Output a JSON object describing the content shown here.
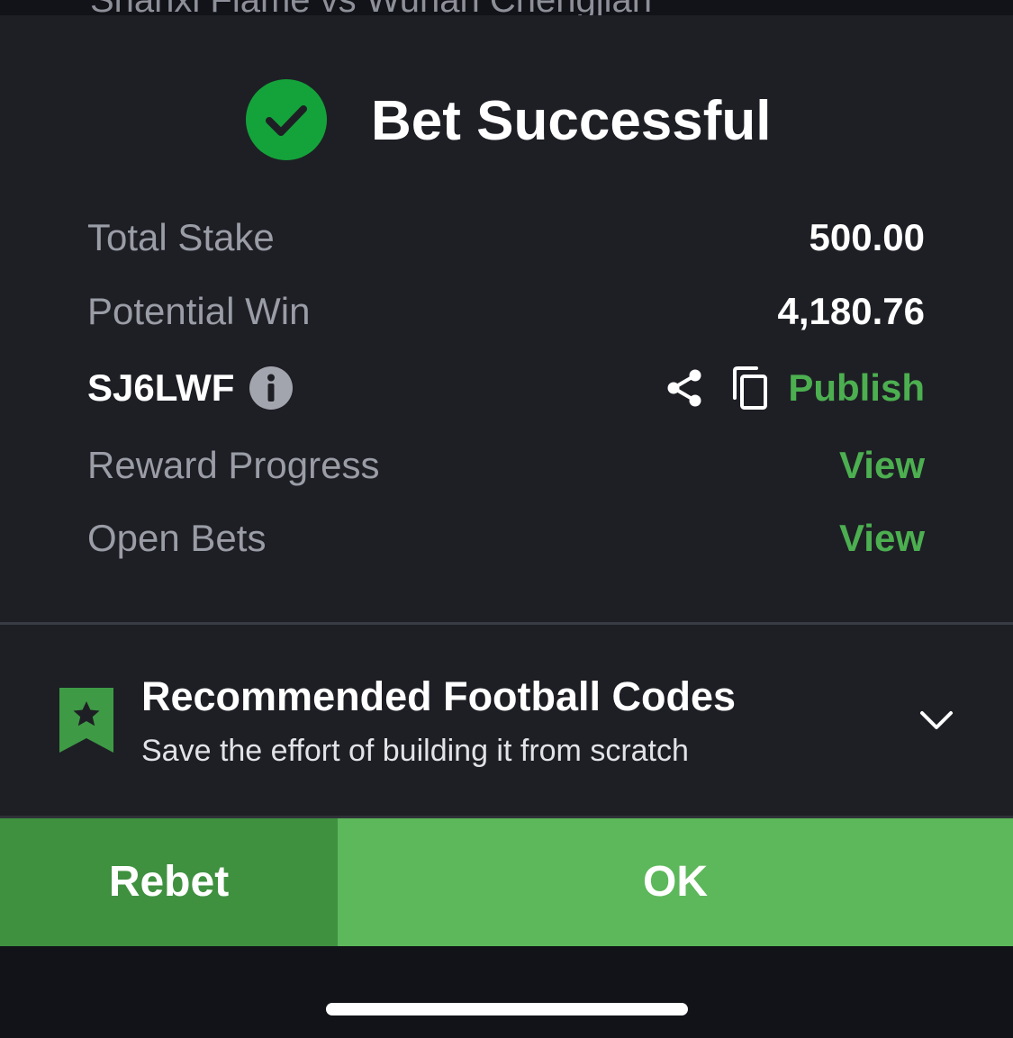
{
  "match_title_cut": "Shanxi Flame vs Wuhan Chengjian",
  "header": {
    "icon": "check-circle-icon",
    "title": "Bet Successful",
    "icon_color": "#14a33a"
  },
  "summary": {
    "total_stake_label": "Total Stake",
    "total_stake_value": "500.00",
    "potential_win_label": "Potential Win",
    "potential_win_value": "4,180.76"
  },
  "booking": {
    "code": "SJ6LWF",
    "info_icon": "info-icon",
    "share_icon": "share-icon",
    "copy_icon": "copy-icon",
    "publish_label": "Publish"
  },
  "links": {
    "reward_progress_label": "Reward Progress",
    "reward_progress_link": "View",
    "open_bets_label": "Open Bets",
    "open_bets_link": "View"
  },
  "recommended": {
    "icon": "bookmark-star-icon",
    "title": "Recommended Football Codes",
    "subtitle": "Save the effort of building it from scratch",
    "toggle_icon": "chevron-down-icon"
  },
  "actions": {
    "rebet_label": "Rebet",
    "ok_label": "OK"
  },
  "colors": {
    "accent_green": "#4caf50",
    "ok_button": "#5cb85a",
    "rebet_button": "#3f9140",
    "background": "#1e1f25"
  }
}
